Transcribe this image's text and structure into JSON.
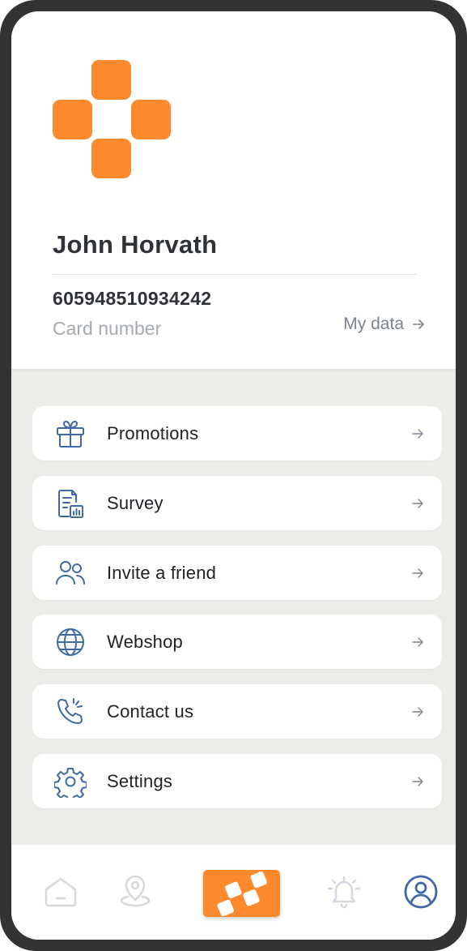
{
  "profile": {
    "name": "John Horvath",
    "card_number": "605948510934242",
    "card_number_label": "Card number",
    "my_data_link": "My data"
  },
  "menu": [
    {
      "label": "Promotions",
      "icon": "gift-icon"
    },
    {
      "label": "Survey",
      "icon": "survey-document-icon"
    },
    {
      "label": "Invite a friend",
      "icon": "users-icon"
    },
    {
      "label": "Webshop",
      "icon": "globe-icon"
    },
    {
      "label": "Contact us",
      "icon": "phone-ringing-icon"
    },
    {
      "label": "Settings",
      "icon": "gear-icon"
    }
  ],
  "bottom_nav": [
    {
      "icon": "home-icon",
      "active": false
    },
    {
      "icon": "map-pin-icon",
      "active": false
    },
    {
      "icon": "loyalty-card-icon",
      "active": false
    },
    {
      "icon": "bell-icon",
      "active": false
    },
    {
      "icon": "user-profile-icon",
      "active": true
    }
  ],
  "colors": {
    "brand_orange": "#ff8a2e",
    "icon_blue": "#3f6aa6",
    "inactive_nav": "#d5d8e0",
    "menu_background": "#ecede8"
  }
}
